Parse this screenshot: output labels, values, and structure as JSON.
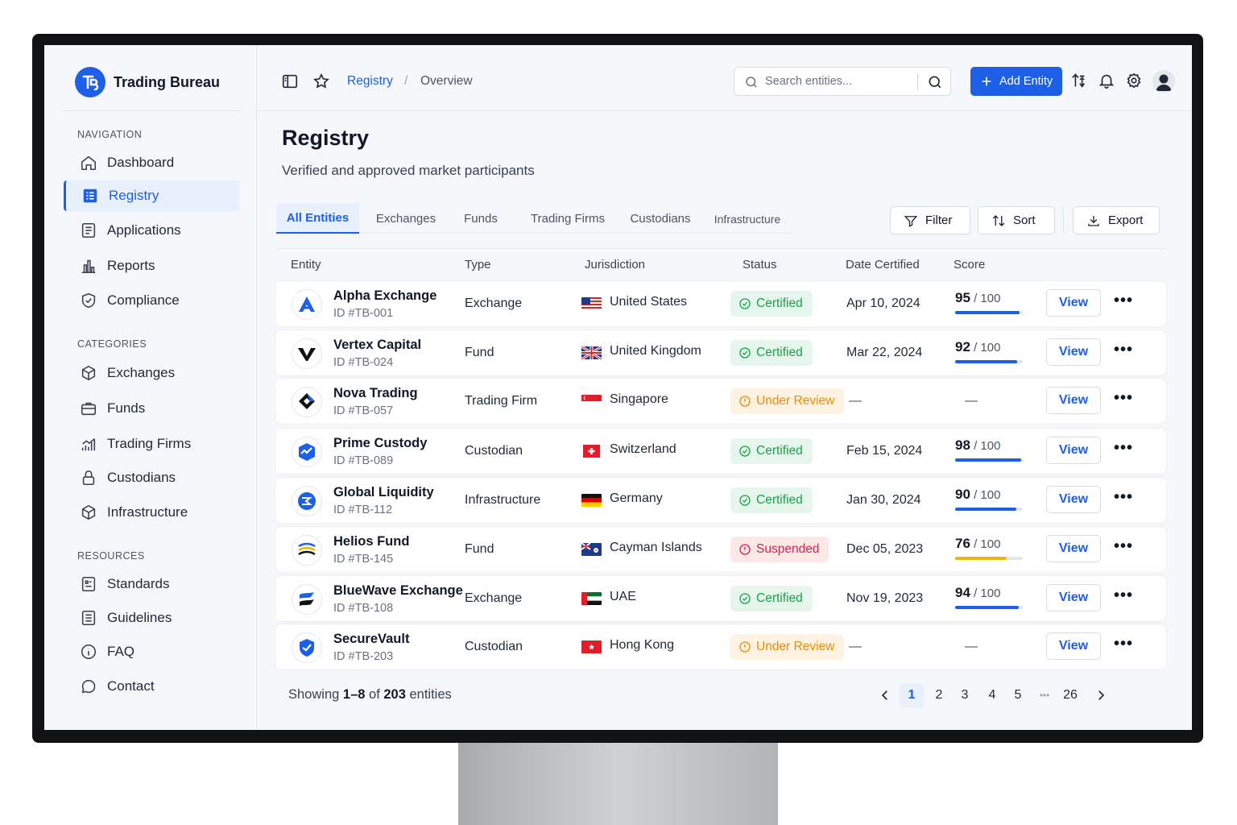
{
  "brand": {
    "name": "Trading Bureau",
    "color": "#1d5fe6"
  },
  "sidebar": {
    "sections": [
      {
        "label": "NAVIGATION"
      },
      {
        "label": "CATEGORIES"
      },
      {
        "label": "RESOURCES"
      }
    ],
    "navigation": [
      {
        "label": "Dashboard",
        "icon": "home-icon"
      },
      {
        "label": "Registry",
        "icon": "grid-list-icon",
        "active": true
      },
      {
        "label": "Applications",
        "icon": "document-icon"
      },
      {
        "label": "Reports",
        "icon": "bar-chart-icon"
      },
      {
        "label": "Compliance",
        "icon": "shield-check-icon"
      }
    ],
    "categories": [
      {
        "label": "Exchanges",
        "icon": "cube-icon"
      },
      {
        "label": "Funds",
        "icon": "briefcase-icon"
      },
      {
        "label": "Trading Firms",
        "icon": "trend-chart-icon"
      },
      {
        "label": "Custodians",
        "icon": "lock-icon"
      },
      {
        "label": "Infrastructure",
        "icon": "cube-icon"
      }
    ],
    "resources": [
      {
        "label": "Standards",
        "icon": "standards-doc-icon"
      },
      {
        "label": "Guidelines",
        "icon": "list-doc-icon"
      },
      {
        "label": "FAQ",
        "icon": "info-circle-icon"
      },
      {
        "label": "Contact",
        "icon": "chat-bubble-icon"
      }
    ]
  },
  "topbar": {
    "breadcrumb": {
      "root": "Registry",
      "separator": "/",
      "current": "Overview"
    },
    "search_placeholder": "Search entities...",
    "add_button": "Add Entity"
  },
  "page": {
    "title": "Registry",
    "subtitle": "Verified and approved market participants"
  },
  "tabs": [
    {
      "label": "All Entities",
      "active": true
    },
    {
      "label": "Exchanges"
    },
    {
      "label": "Funds"
    },
    {
      "label": "Trading Firms"
    },
    {
      "label": "Custodians"
    },
    {
      "label": "Infrastructure"
    }
  ],
  "toolbar": {
    "filter": "Filter",
    "sort": "Sort",
    "export": "Export"
  },
  "table": {
    "columns": [
      "Entity",
      "Type",
      "Jurisdiction",
      "Status",
      "Date Certified",
      "Score"
    ],
    "view_label": "View",
    "more_label": "•••",
    "score_suffix": "/ 100",
    "rows": [
      {
        "name": "Alpha Exchange",
        "id": "ID #TB-001",
        "type": "Exchange",
        "jurisdiction": "United States",
        "flag": "us-flag",
        "status": "Certified",
        "status_kind": "ok",
        "date": "Apr 10, 2024",
        "score": "95",
        "score_fraction": 0.95,
        "bar_color": "#1d5fe6"
      },
      {
        "name": "Vertex Capital",
        "id": "ID #TB-024",
        "type": "Fund",
        "jurisdiction": "United Kingdom",
        "flag": "uk-flag",
        "status": "Certified",
        "status_kind": "ok",
        "date": "Mar 22, 2024",
        "score": "92",
        "score_fraction": 0.92,
        "bar_color": "#1d5fe6"
      },
      {
        "name": "Nova Trading",
        "id": "ID #TB-057",
        "type": "Trading Firm",
        "jurisdiction": "Singapore",
        "flag": "sg-flag",
        "status": "Under Review",
        "status_kind": "rev",
        "date": "—",
        "score": "—",
        "score_fraction": null
      },
      {
        "name": "Prime Custody",
        "id": "ID #TB-089",
        "type": "Custodian",
        "jurisdiction": "Switzerland",
        "flag": "ch-flag",
        "status": "Certified",
        "status_kind": "ok",
        "date": "Feb 15, 2024",
        "score": "98",
        "score_fraction": 0.98,
        "bar_color": "#1d5fe6"
      },
      {
        "name": "Global Liquidity",
        "id": "ID #TB-112",
        "type": "Infrastructure",
        "jurisdiction": "Germany",
        "flag": "de-flag",
        "status": "Certified",
        "status_kind": "ok",
        "date": "Jan 30, 2024",
        "score": "90",
        "score_fraction": 0.9,
        "bar_color": "#1d5fe6"
      },
      {
        "name": "Helios Fund",
        "id": "ID #TB-145",
        "type": "Fund",
        "jurisdiction": "Cayman Islands",
        "flag": "ky-flag",
        "status": "Suspended",
        "status_kind": "sus",
        "date": "Dec 05, 2023",
        "score": "76",
        "score_fraction": 0.76,
        "bar_color": "#f5b400"
      },
      {
        "name": "BlueWave Exchange",
        "id": "ID #TB-108",
        "type": "Exchange",
        "jurisdiction": "UAE",
        "flag": "ae-flag",
        "status": "Certified",
        "status_kind": "ok",
        "date": "Nov 19, 2023",
        "score": "94",
        "score_fraction": 0.94,
        "bar_color": "#1d5fe6"
      },
      {
        "name": "SecureVault",
        "id": "ID #TB-203",
        "type": "Custodian",
        "jurisdiction": "Hong Kong",
        "flag": "hk-flag",
        "status": "Under Review",
        "status_kind": "rev",
        "date": "—",
        "score": "—",
        "score_fraction": null
      }
    ]
  },
  "footer": {
    "showing_prefix": "Showing",
    "range": "1–8",
    "of": "of",
    "total": "203",
    "suffix": "entities",
    "pages": [
      "1",
      "2",
      "3",
      "4",
      "5",
      "•••",
      "26"
    ],
    "current_page": "1"
  }
}
